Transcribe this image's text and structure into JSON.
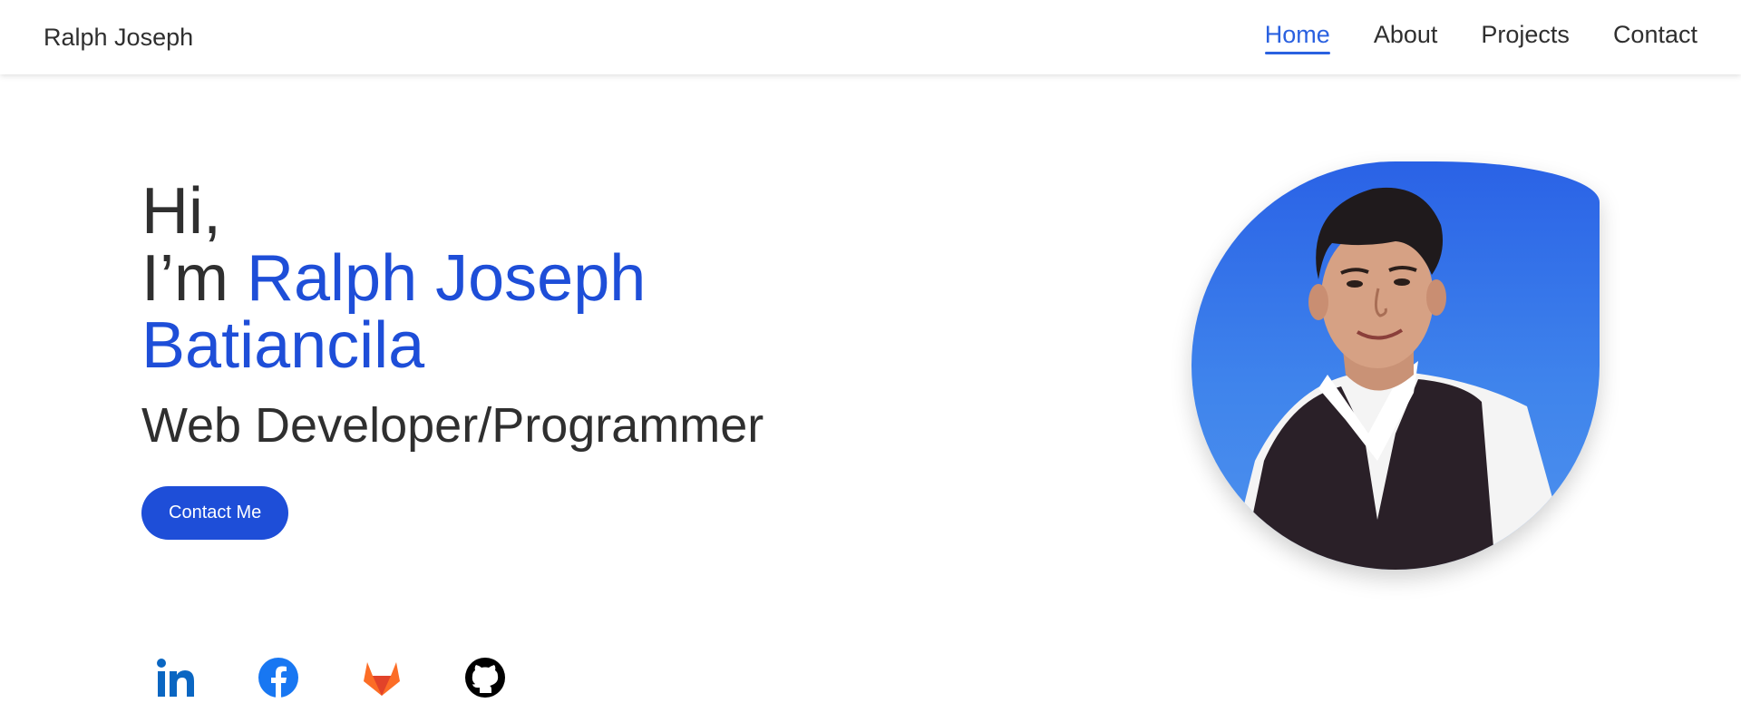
{
  "header": {
    "logo": "Ralph Joseph",
    "nav": [
      {
        "label": "Home",
        "active": true
      },
      {
        "label": "About",
        "active": false
      },
      {
        "label": "Projects",
        "active": false
      },
      {
        "label": "Contact",
        "active": false
      }
    ]
  },
  "hero": {
    "line1": "Hi,",
    "line2_prefix": "I’m ",
    "name_part1": "Ralph Joseph",
    "name_part2": "Batiancila",
    "role": "Web Developer/Programmer",
    "cta_label": "Contact Me"
  },
  "photo": {
    "icon": "profile-photo"
  },
  "socials": [
    {
      "name": "linkedin-icon",
      "color": "#0a66c2"
    },
    {
      "name": "facebook-icon",
      "color": "#1877f2"
    },
    {
      "name": "gitlab-icon",
      "color": "#fc6d26"
    },
    {
      "name": "github-icon",
      "color": "#000000"
    }
  ],
  "colors": {
    "accent": "#1e4ed8",
    "nav_active": "#2a61e0"
  }
}
